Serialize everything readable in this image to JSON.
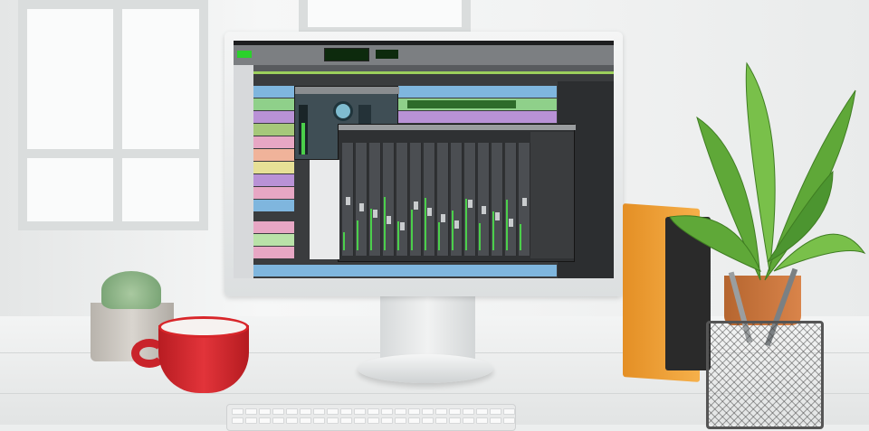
{
  "scene": {
    "objects": [
      "monitor",
      "daw-software",
      "red-cup",
      "succulent",
      "books",
      "potted-plant",
      "pencil-holder",
      "keyboard"
    ],
    "colors": {
      "cup": "#d8262a",
      "books": "#f0a33a",
      "plant": "#5fa838",
      "screen_bg": "#3a3c3e",
      "track_blue": "#7fb6de",
      "track_green": "#8fd08a",
      "track_pink": "#e7a7c4",
      "track_purple": "#b992d6",
      "meter_green": "#4bcf4b"
    }
  }
}
